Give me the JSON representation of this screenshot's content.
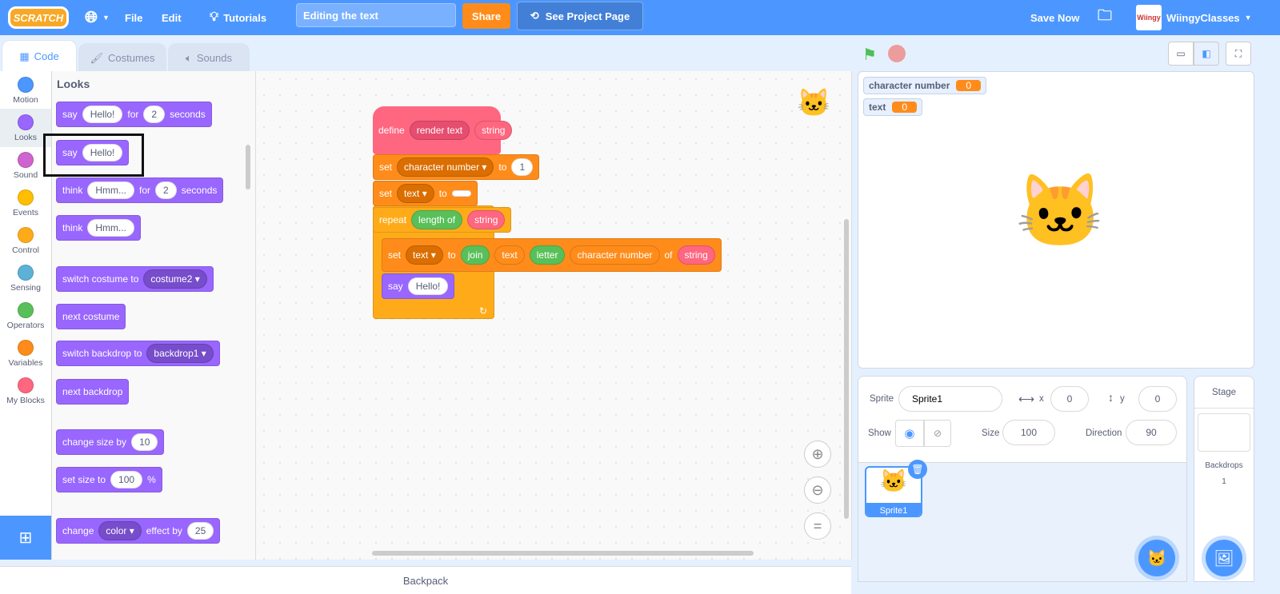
{
  "menubar": {
    "logo": "SCRATCH",
    "file": "File",
    "edit": "Edit",
    "tutorials": "Tutorials",
    "project_title": "Editing the text",
    "share": "Share",
    "see_project_page": "See Project Page",
    "save_now": "Save Now",
    "username": "WiingyClasses",
    "avatar_text": "Wiingy"
  },
  "tabs": [
    {
      "label": "Code",
      "icon": "code-icon"
    },
    {
      "label": "Costumes",
      "icon": "brush-icon"
    },
    {
      "label": "Sounds",
      "icon": "speaker-icon"
    }
  ],
  "categories": [
    {
      "label": "Motion",
      "color": "#4c97ff"
    },
    {
      "label": "Looks",
      "color": "#9966ff"
    },
    {
      "label": "Sound",
      "color": "#cf63cf"
    },
    {
      "label": "Events",
      "color": "#ffbf00"
    },
    {
      "label": "Control",
      "color": "#ffab19"
    },
    {
      "label": "Sensing",
      "color": "#5cb1d6"
    },
    {
      "label": "Operators",
      "color": "#59c059"
    },
    {
      "label": "Variables",
      "color": "#ff8c1a"
    },
    {
      "label": "My Blocks",
      "color": "#ff6680"
    }
  ],
  "colors": {
    "looks": "#9966ff",
    "variables": "#ff8c1a",
    "control": "#ffab19",
    "operators": "#59c059",
    "myblocks": "#ff6680",
    "accent": "#4c97ff"
  },
  "palette": {
    "heading": "Looks",
    "blocks": [
      {
        "c": "looks",
        "parts": [
          [
            "t",
            "say"
          ],
          [
            "i",
            "Hello!"
          ],
          [
            "t",
            "for"
          ],
          [
            "i",
            "2"
          ],
          [
            "t",
            "seconds"
          ]
        ]
      },
      {
        "c": "looks",
        "parts": [
          [
            "t",
            "say"
          ],
          [
            "i",
            "Hello!"
          ]
        ],
        "highlighted": true
      },
      {
        "c": "looks",
        "parts": [
          [
            "t",
            "think"
          ],
          [
            "i",
            "Hmm..."
          ],
          [
            "t",
            "for"
          ],
          [
            "i",
            "2"
          ],
          [
            "t",
            "seconds"
          ]
        ]
      },
      {
        "c": "looks",
        "parts": [
          [
            "t",
            "think"
          ],
          [
            "i",
            "Hmm..."
          ]
        ]
      },
      {
        "c": "looks",
        "parts": [
          [
            "t",
            "switch costume to"
          ],
          [
            "d",
            "costume2"
          ]
        ]
      },
      {
        "c": "looks",
        "parts": [
          [
            "t",
            "next costume"
          ]
        ]
      },
      {
        "c": "looks",
        "parts": [
          [
            "t",
            "switch backdrop to"
          ],
          [
            "d",
            "backdrop1"
          ]
        ]
      },
      {
        "c": "looks",
        "parts": [
          [
            "t",
            "next backdrop"
          ]
        ]
      },
      {
        "c": "looks",
        "parts": [
          [
            "t",
            "change size by"
          ],
          [
            "i",
            "10"
          ]
        ]
      },
      {
        "c": "looks",
        "parts": [
          [
            "t",
            "set size to"
          ],
          [
            "i",
            "100"
          ],
          [
            "t",
            "%"
          ]
        ]
      },
      {
        "c": "looks",
        "parts": [
          [
            "t",
            "change"
          ],
          [
            "d",
            "color"
          ],
          [
            "t",
            "effect by"
          ],
          [
            "i",
            "25"
          ]
        ]
      }
    ]
  },
  "script": [
    {
      "c": "myblocks",
      "parts": [
        [
          "t",
          "define"
        ],
        [
          "p",
          "render text"
        ],
        [
          "r",
          "string",
          "myblocks"
        ]
      ]
    },
    {
      "c": "variables",
      "parts": [
        [
          "t",
          "set"
        ],
        [
          "d",
          "character number"
        ],
        [
          "t",
          "to"
        ],
        [
          "i",
          "1"
        ]
      ]
    },
    {
      "c": "variables",
      "parts": [
        [
          "t",
          "set"
        ],
        [
          "d",
          "text"
        ],
        [
          "t",
          "to"
        ],
        [
          "i",
          ""
        ]
      ]
    },
    {
      "c": "control",
      "parts": [
        [
          "t",
          "repeat"
        ],
        [
          "r",
          "length of",
          "operators"
        ],
        [
          "r",
          "string",
          "myblocks"
        ]
      ]
    },
    {
      "c": "variables",
      "parts": [
        [
          "t",
          "set"
        ],
        [
          "d",
          "text"
        ],
        [
          "t",
          "to"
        ],
        [
          "r",
          "join",
          "operators"
        ],
        [
          "r",
          "text",
          "variables"
        ],
        [
          "r",
          "letter",
          "operators"
        ],
        [
          "r",
          "character number",
          "variables"
        ],
        [
          "t",
          "of"
        ],
        [
          "r",
          "string",
          "myblocks"
        ]
      ]
    },
    {
      "c": "looks",
      "parts": [
        [
          "t",
          "say"
        ],
        [
          "i",
          "Hello!"
        ]
      ]
    }
  ],
  "monitors": [
    {
      "label": "character number",
      "value": "0"
    },
    {
      "label": "text",
      "value": "0"
    }
  ],
  "sprite_info": {
    "sprite_label": "Sprite",
    "sprite_name": "Sprite1",
    "x_label": "x",
    "x": "0",
    "y_label": "y",
    "y": "0",
    "show_label": "Show",
    "size_label": "Size",
    "size": "100",
    "direction_label": "Direction",
    "direction": "90"
  },
  "sprites": [
    {
      "name": "Sprite1",
      "selected": true
    }
  ],
  "stage_pane": {
    "title": "Stage",
    "backdrops_label": "Backdrops",
    "backdrops_count": "1"
  },
  "backpack": "Backpack"
}
